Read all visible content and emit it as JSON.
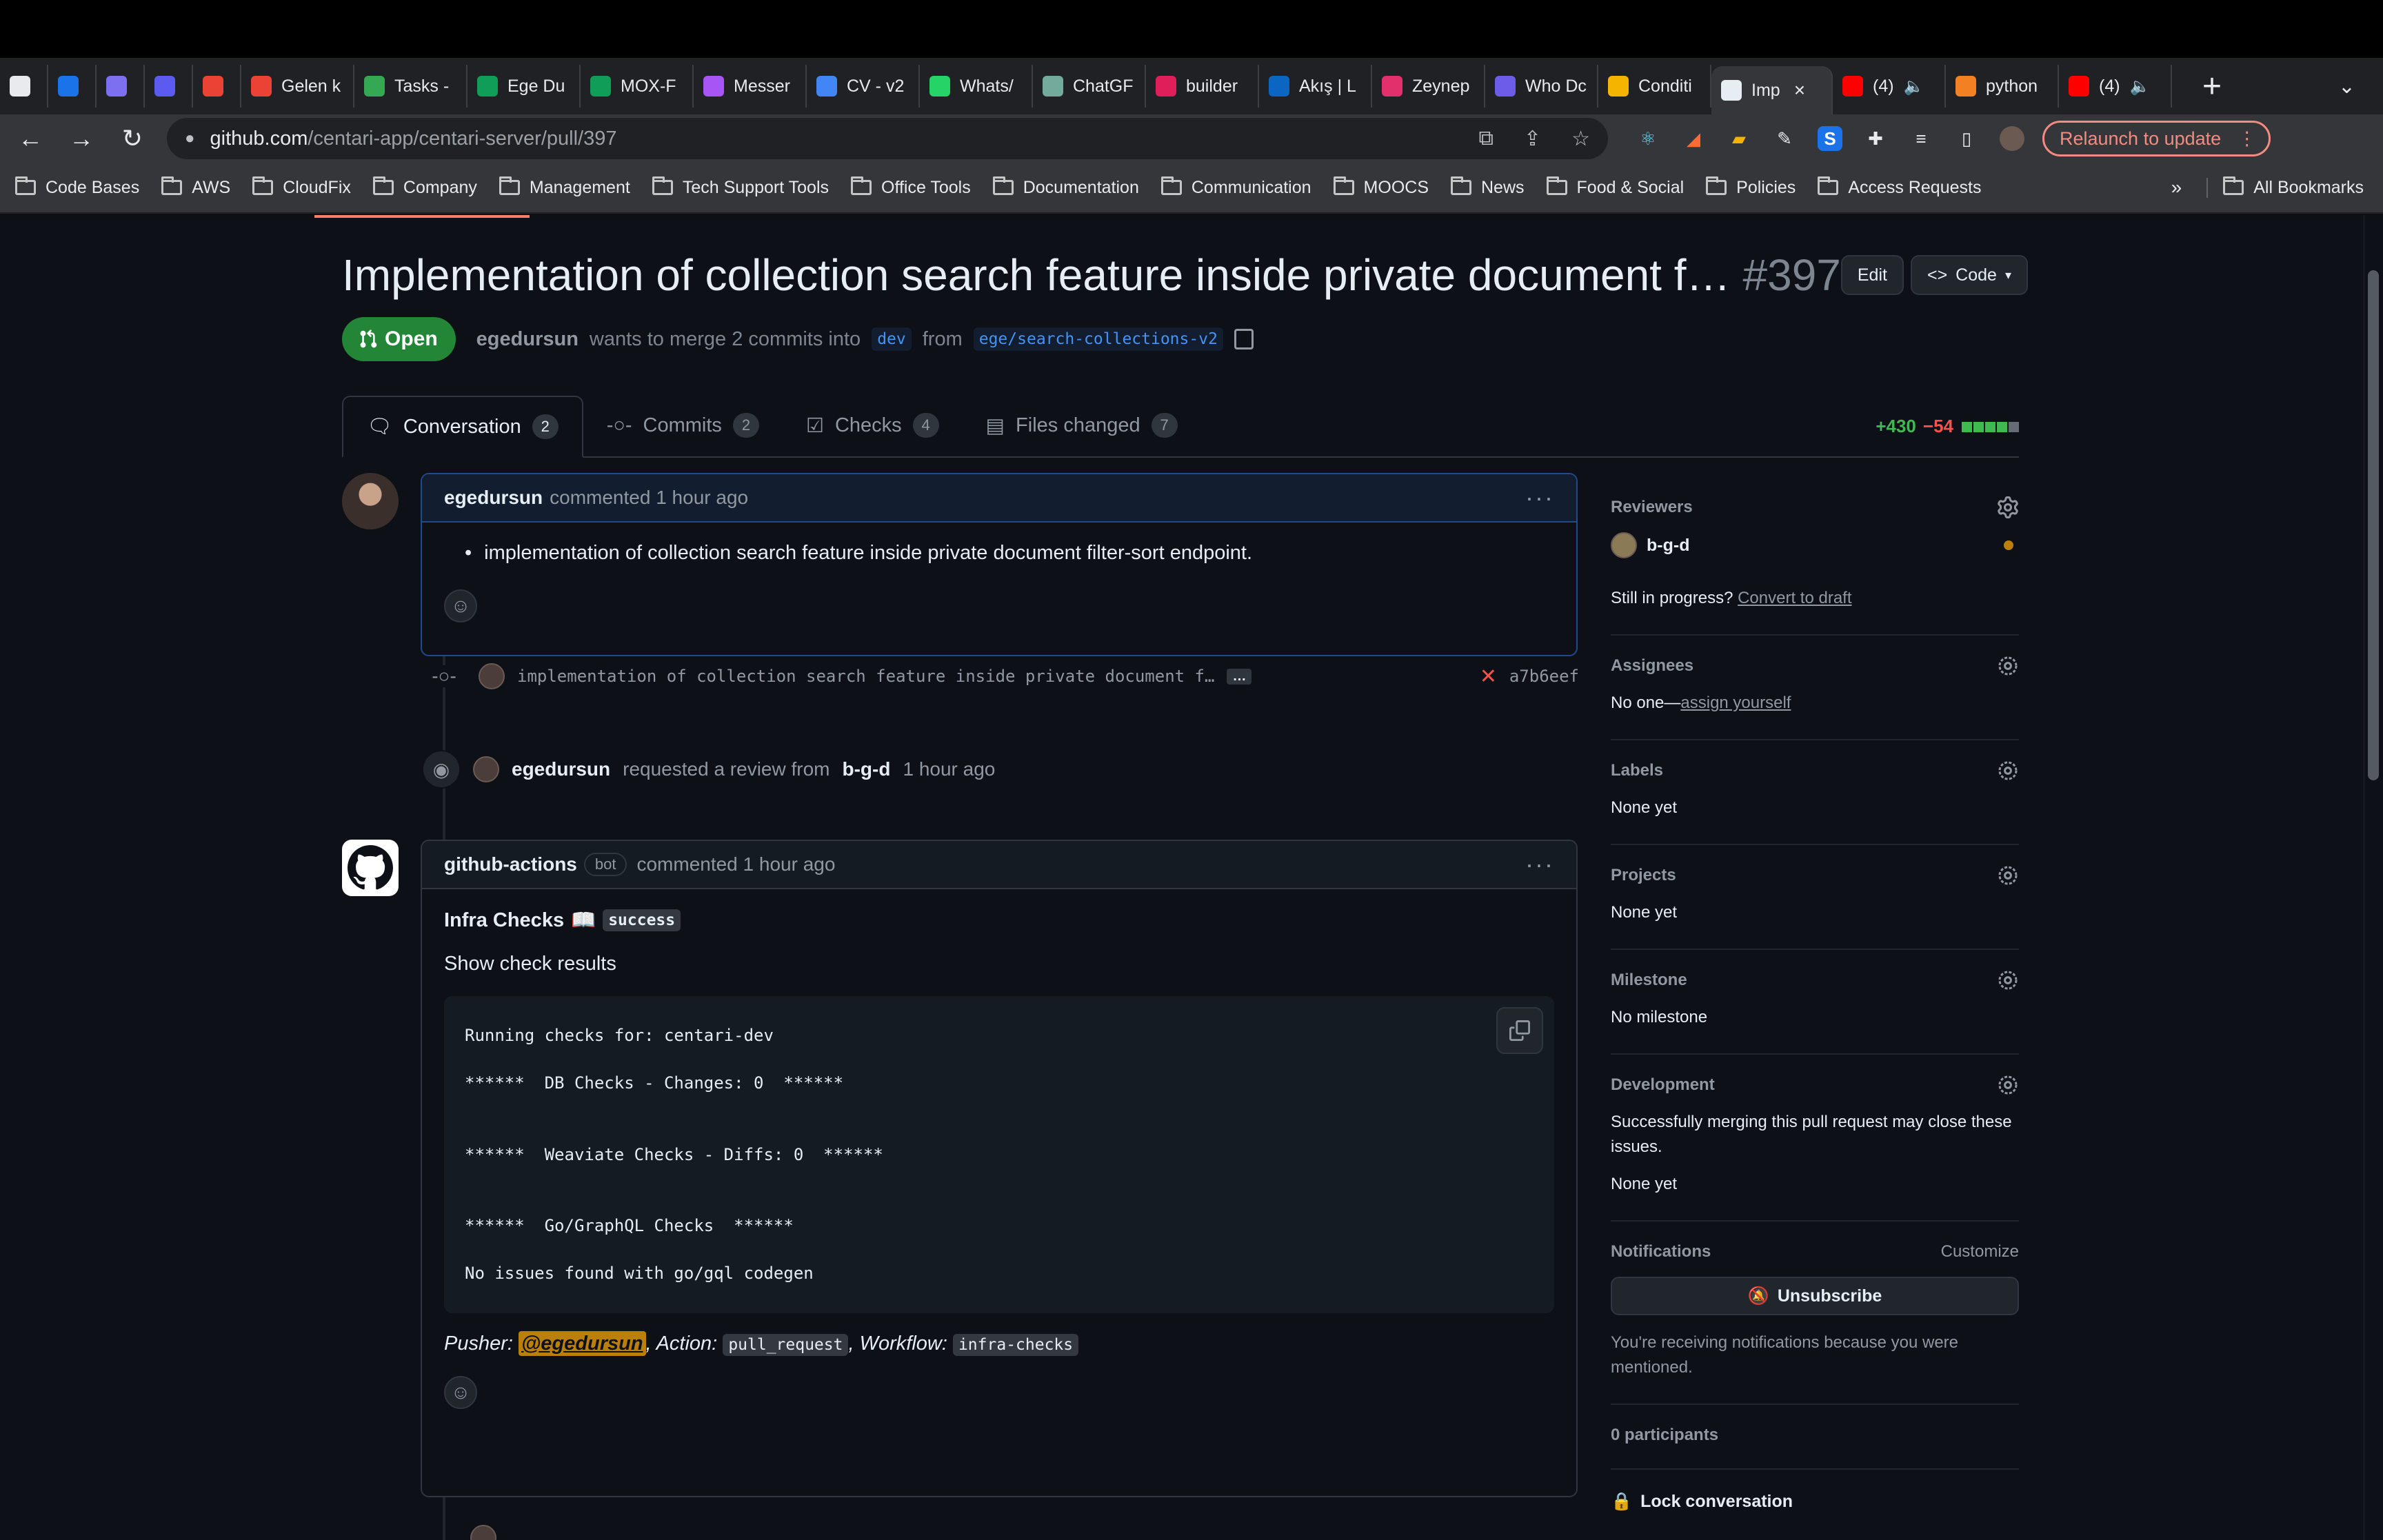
{
  "browser": {
    "tabs": [
      {
        "label": "",
        "color": "#e8eaed"
      },
      {
        "label": "",
        "color": "#1a73e8"
      },
      {
        "label": "",
        "color": "#7c6ff0"
      },
      {
        "label": "",
        "color": "#5b5bf0"
      },
      {
        "label": "",
        "color": "#ea4335"
      },
      {
        "label": "Gelen k",
        "color": "#ea4335"
      },
      {
        "label": "Tasks -",
        "color": "#34a853"
      },
      {
        "label": "Ege Du",
        "color": "#0f9d58"
      },
      {
        "label": "MOX-F",
        "color": "#0f9d58"
      },
      {
        "label": "Messer",
        "color": "#a855f7"
      },
      {
        "label": "CV - v2",
        "color": "#4285f4"
      },
      {
        "label": "Whats/",
        "color": "#25d366"
      },
      {
        "label": "ChatGF",
        "color": "#74aa9c"
      },
      {
        "label": "builder",
        "color": "#e01e5a"
      },
      {
        "label": "Akış | L",
        "color": "#0a66c2"
      },
      {
        "label": "Zeynep",
        "color": "#e1306c"
      },
      {
        "label": "Who Dc",
        "color": "#6c5ce7"
      },
      {
        "label": "Conditi",
        "color": "#f4b400"
      },
      {
        "label": "Imp",
        "color": "#e6edf3",
        "active": true
      },
      {
        "label": "(4)",
        "color": "#ff0000",
        "audio": true
      },
      {
        "label": "python",
        "color": "#f48024"
      },
      {
        "label": "(4)",
        "color": "#ff0000",
        "audio": true
      }
    ],
    "url_host": "github.com",
    "url_path": "/centari-app/centari-server/pull/397",
    "relaunch_label": "Relaunch to update",
    "bookmarks": [
      "Code Bases",
      "AWS",
      "CloudFix",
      "Company",
      "Management",
      "Tech Support Tools",
      "Office Tools",
      "Documentation",
      "Communication",
      "MOOCS",
      "News",
      "Food & Social",
      "Policies",
      "Access Requests"
    ],
    "bookmarks_more": "»",
    "all_bookmarks": "All Bookmarks"
  },
  "pr": {
    "title": "Implementation of collection search feature inside private document f…",
    "number": "#397",
    "edit_label": "Edit",
    "code_label": "Code",
    "state": "Open",
    "author": "egedursun",
    "merge_text": "wants to merge 2 commits into",
    "base_branch": "dev",
    "from_text": "from",
    "head_branch": "ege/search-collections-v2",
    "tabs": [
      {
        "label": "Conversation",
        "count": "2"
      },
      {
        "label": "Commits",
        "count": "2"
      },
      {
        "label": "Checks",
        "count": "4"
      },
      {
        "label": "Files changed",
        "count": "7"
      }
    ],
    "additions": "+430",
    "deletions": "−54"
  },
  "timeline": {
    "comment1": {
      "author": "egedursun",
      "action": "commented 1 hour ago",
      "body": "implementation of collection search feature inside private document filter-sort endpoint."
    },
    "commit": {
      "message": "implementation of collection search feature inside private document f…",
      "ellipsis": "…",
      "sha": "a7b6eef",
      "status": "✕"
    },
    "review_event": {
      "actor": "egedursun",
      "text": "requested a review from",
      "reviewer": "b-g-d",
      "time": "1 hour ago"
    },
    "comment2": {
      "author": "github-actions",
      "badge": "bot",
      "action": "commented 1 hour ago",
      "heading": "Infra Checks",
      "heading_emoji": "📖",
      "status": "success",
      "summary": "Show check results",
      "code": "Running checks for: centari-dev\n\n******  DB Checks - Changes: 0  ******\n\n\n******  Weaviate Checks - Diffs: 0  ******\n\n\n******  Go/GraphQL Checks  ******\n\nNo issues found with go/gql codegen",
      "pusher_label": "Pusher:",
      "pusher": "@egedursun",
      "action_label": ", Action:",
      "action_value": "pull_request",
      "workflow_label": ", Workflow:",
      "workflow_value": "infra-checks"
    }
  },
  "sidebar": {
    "reviewers_title": "Reviewers",
    "reviewer": "b-g-d",
    "in_progress": "Still in progress?",
    "convert_draft": "Convert to draft",
    "assignees_title": "Assignees",
    "assignees_none": "No one—",
    "assign_yourself": "assign yourself",
    "labels_title": "Labels",
    "labels_value": "None yet",
    "projects_title": "Projects",
    "projects_value": "None yet",
    "milestone_title": "Milestone",
    "milestone_value": "No milestone",
    "development_title": "Development",
    "development_text": "Successfully merging this pull request may close these issues.",
    "development_value": "None yet",
    "notifications_title": "Notifications",
    "customize": "Customize",
    "unsubscribe": "Unsubscribe",
    "notif_reason": "You're receiving notifications because you were mentioned.",
    "participants": "0 participants",
    "lock": "Lock conversation"
  }
}
